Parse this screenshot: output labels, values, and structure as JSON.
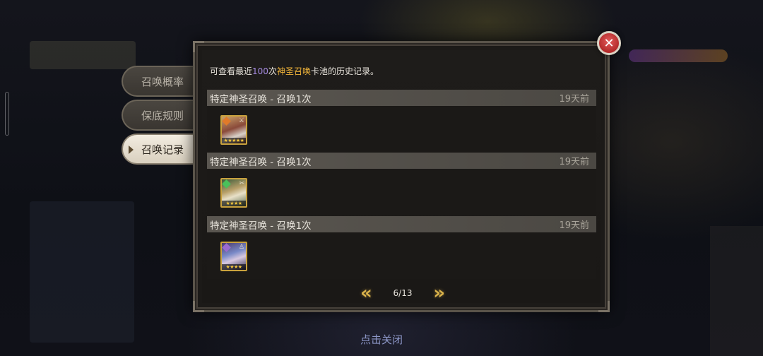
{
  "tabs": [
    {
      "label": "召唤概率",
      "active": false
    },
    {
      "label": "保底规则",
      "active": false
    },
    {
      "label": "召唤记录",
      "active": true
    }
  ],
  "intro": {
    "prefix": "可查看最近",
    "count": "100",
    "middle": "次",
    "pool_name": "神圣召唤",
    "suffix": "卡池的历史记录。"
  },
  "records": [
    {
      "title": "特定神圣召唤 - 召唤1次",
      "time": "19天前",
      "hero": {
        "element": "fire",
        "stars": "★★★★★"
      }
    },
    {
      "title": "特定神圣召唤 - 召唤1次",
      "time": "19天前",
      "hero": {
        "element": "earth",
        "stars": "★★★★"
      }
    },
    {
      "title": "特定神圣召唤 - 召唤1次",
      "time": "19天前",
      "hero": {
        "element": "dark",
        "stars": "★★★★"
      }
    }
  ],
  "pager": {
    "page": "6/13"
  },
  "close_hint": "点击关闭",
  "colors": {
    "accent_gold": "#f0b43a",
    "accent_purple": "#a58be0",
    "close_red": "#c23a3a"
  }
}
